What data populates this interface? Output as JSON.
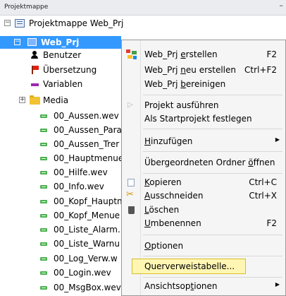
{
  "panel": {
    "title": "Projektmappe",
    "pin_glyph": "–"
  },
  "tree": {
    "solution": "Projektmappe Web_Prj",
    "project": "Web_Prj",
    "items": {
      "benutzer": "Benutzer",
      "uebersetzung": "Übersetzung",
      "variablen": "Variablen",
      "media": "Media"
    },
    "files": [
      "00_Aussen.wev",
      "00_Aussen_Para",
      "00_Aussen_Trer",
      "00_Hauptmenue",
      "00_Hilfe.wev",
      "00_Info.wev",
      "00_Kopf_Hauptn",
      "00_Kopf_Menue",
      "00_Liste_Alarm.",
      "00_Liste_Warnu",
      "00_Log_Verw.w",
      "00_Login.wev",
      "00_MsgBox.wev"
    ]
  },
  "menu": {
    "build": {
      "pre": "Web_Prj ",
      "u": "e",
      "post": "rstellen",
      "shortcut": "F2"
    },
    "rebuild": {
      "pre": "Web_Prj ",
      "u": "n",
      "post": "eu erstellen",
      "shortcut": "Ctrl+F2"
    },
    "clean": {
      "pre": "Web_Prj ",
      "u": "b",
      "post": "ereinigen"
    },
    "run": {
      "label": "Projekt ausführen"
    },
    "startup": {
      "label": "Als Startprojekt festlegen"
    },
    "add": {
      "u": "H",
      "post": "inzufügen"
    },
    "open_parent": {
      "pre": "Übergeordneten Ordner ",
      "u": "ö",
      "post": "ffnen"
    },
    "copy": {
      "u": "K",
      "post": "opieren",
      "shortcut": "Ctrl+C"
    },
    "cut": {
      "u": "A",
      "post": "usschneiden",
      "shortcut": "Ctrl+X"
    },
    "delete": {
      "u": "L",
      "post": "öschen"
    },
    "rename": {
      "u": "U",
      "post": "mbenennen",
      "shortcut": "F2"
    },
    "options": {
      "u": "O",
      "post": "ptionen"
    },
    "xref": {
      "label": "Querverweistabelle..."
    },
    "view_options": {
      "pre": "Ansichtsop",
      "u": "t",
      "post": "ionen"
    }
  },
  "colors": {
    "selection": "#3399ff",
    "highlight": "#fff6b3",
    "highlight_border": "#d8bd2b"
  }
}
